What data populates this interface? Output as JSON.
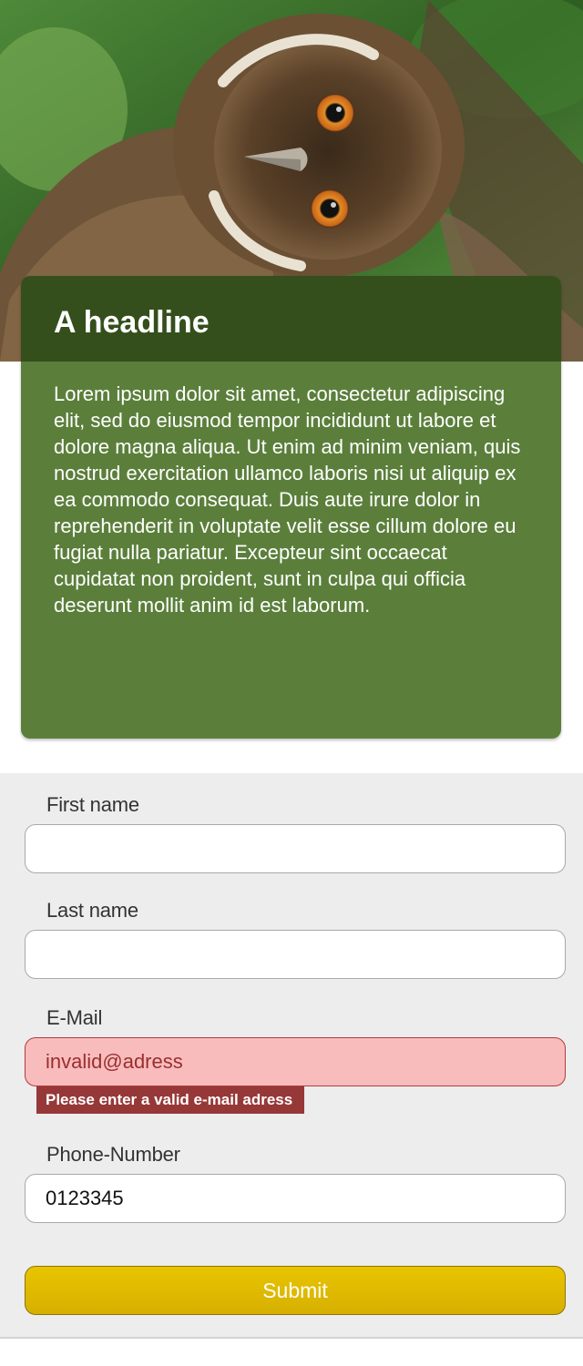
{
  "hero": {
    "image": "owl-photo",
    "colors": {
      "foliage": "#3d6b2a",
      "owl": "#6e5438",
      "eye": "#e0862a"
    }
  },
  "card": {
    "headline": "A headline",
    "body": "Lorem ipsum dolor sit amet, consectetur adipiscing elit, sed do eiusmod tempor incididunt ut labore et dolore magna aliqua. Ut enim ad minim veniam, quis nostrud exercitation ullamco laboris nisi ut aliquip ex ea commodo consequat. Duis aute irure dolor in reprehenderit in voluptate velit esse cillum dolore eu fugiat nulla pariatur. Excepteur sint occaecat cupidatat non proident, sunt in culpa qui officia deserunt mollit anim id est laborum.",
    "colors": {
      "header": "#344f1b",
      "body": "#5b7f3b"
    }
  },
  "form": {
    "first_name": {
      "label": "First name",
      "value": ""
    },
    "last_name": {
      "label": "Last name",
      "value": ""
    },
    "email": {
      "label": "E-Mail",
      "value": "invalid@adress",
      "error": "Please enter a valid e-mail adress"
    },
    "phone": {
      "label": "Phone-Number",
      "value": "0123345"
    },
    "submit_label": "Submit",
    "colors": {
      "error": "#973838",
      "invalid_bg": "#f9bcbc",
      "submit": "#e2bd00"
    }
  }
}
